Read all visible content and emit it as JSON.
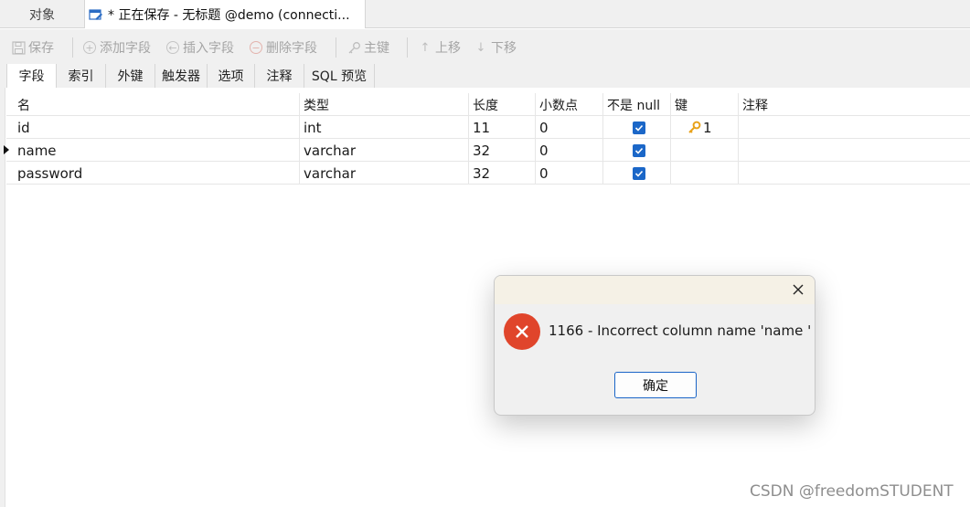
{
  "tabs": {
    "objects_label": "对象",
    "active_title": "* 正在保存 - 无标题 @demo (connecti..."
  },
  "toolbar": {
    "save": "保存",
    "add_field": "添加字段",
    "insert_field": "插入字段",
    "delete_field": "删除字段",
    "primary_key": "主键",
    "move_up": "上移",
    "move_down": "下移"
  },
  "subtabs": [
    "字段",
    "索引",
    "外键",
    "触发器",
    "选项",
    "注释",
    "SQL 预览"
  ],
  "grid": {
    "headers": [
      "名",
      "类型",
      "长度",
      "小数点",
      "不是 null",
      "键",
      "注释"
    ],
    "rows": [
      {
        "name": "id",
        "type": "int",
        "length": "11",
        "decimals": "0",
        "not_null": true,
        "key": "1"
      },
      {
        "name": "name",
        "type": "varchar",
        "length": "32",
        "decimals": "0",
        "not_null": true,
        "key": ""
      },
      {
        "name": "password",
        "type": "varchar",
        "length": "32",
        "decimals": "0",
        "not_null": true,
        "key": ""
      }
    ]
  },
  "dialog": {
    "message": "1166 - Incorrect column name 'name '",
    "ok_label": "确定"
  },
  "watermark": "CSDN @freedomSTUDENT",
  "colors": {
    "checkbox": "#1b67c8",
    "error_icon": "#e0452b",
    "key_icon": "#e8a21a",
    "dialog_title_bar": "#f5f1e6"
  },
  "icons": {
    "save": "save-icon",
    "add": "plus-circle-icon",
    "insert": "arrow-left-circle-icon",
    "delete": "minus-circle-icon",
    "primary_key": "key-icon",
    "up": "arrow-up-icon",
    "down": "arrow-down-icon",
    "error": "error-x-icon",
    "close": "close-icon"
  }
}
